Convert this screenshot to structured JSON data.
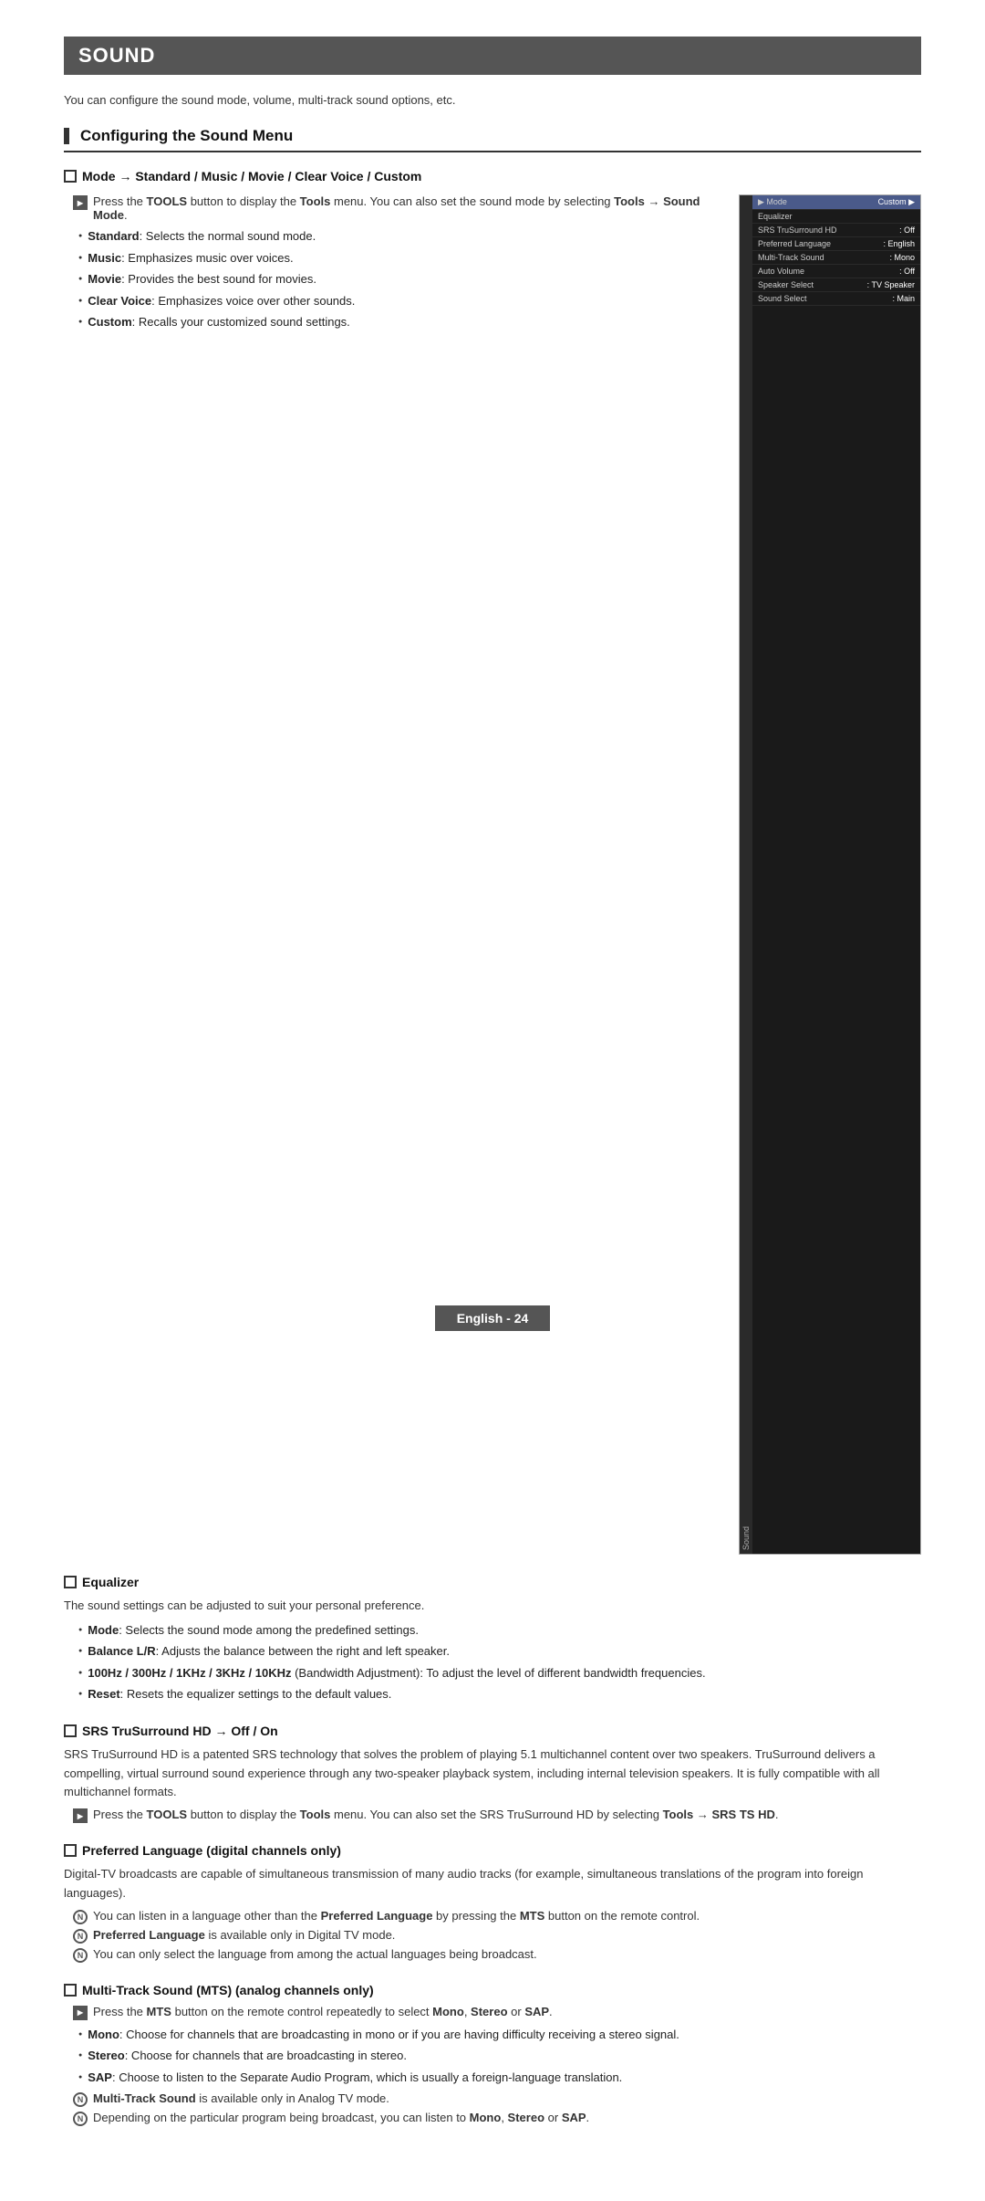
{
  "page": {
    "title": "SOUND",
    "intro": "You can configure the sound mode, volume, multi-track sound options, etc.",
    "footer_label": "English - 24"
  },
  "configuring_section": {
    "heading": "Configuring the Sound Menu"
  },
  "mode_subsection": {
    "title": "Mode → Standard / Music / Movie / Clear Voice / Custom",
    "note1": "Press the TOOLS button to display the Tools menu. You can also set the sound mode by selecting Tools → Sound Mode.",
    "bullets": [
      {
        "text": "Standard: Selects the normal sound mode."
      },
      {
        "text": "Music: Emphasizes music over voices."
      },
      {
        "text": "Movie: Provides the best sound for movies."
      },
      {
        "text": "Clear Voice: Emphasizes voice over other sounds."
      },
      {
        "text": "Custom: Recalls your customized sound settings."
      }
    ]
  },
  "tv_menu": {
    "sidebar_label": "Sound",
    "header_label": "",
    "rows": [
      {
        "label": "Mode",
        "value": "Custom",
        "highlighted": true
      },
      {
        "label": "Equalizer",
        "value": ""
      },
      {
        "label": "SRS TruSurround HD",
        "value": ": Off"
      },
      {
        "label": "Preferred Language",
        "value": ": English"
      },
      {
        "label": "Multi-Track Sound",
        "value": ": Mono"
      },
      {
        "label": "Auto Volume",
        "value": ": Off"
      },
      {
        "label": "Speaker Select",
        "value": ": TV Speaker"
      },
      {
        "label": "Sound Select",
        "value": ": Main"
      }
    ]
  },
  "equalizer_subsection": {
    "title": "Equalizer",
    "body": "The sound settings can be adjusted to suit your personal preference.",
    "bullets": [
      {
        "text": "Mode: Selects the sound mode among the predefined settings."
      },
      {
        "text": "Balance L/R: Adjusts the balance between the right and left speaker."
      },
      {
        "text": "100Hz / 300Hz / 1KHz / 3KHz / 10KHz (Bandwidth Adjustment): To adjust the level of different bandwidth frequencies."
      },
      {
        "text": "Reset: Resets the equalizer settings to the default values."
      }
    ]
  },
  "srs_subsection": {
    "title": "SRS TruSurround HD → Off / On",
    "body": "SRS TruSurround HD is a patented SRS technology that solves the problem of playing 5.1 multichannel content over two speakers. TruSurround delivers a compelling, virtual surround sound experience through any two-speaker playback system, including internal television speakers. It is fully compatible with all multichannel formats.",
    "note1": "Press the TOOLS button to display the Tools menu. You can also set the SRS TruSurround HD by selecting Tools → SRS TS HD."
  },
  "preferred_lang_subsection": {
    "title": "Preferred Language (digital channels only)",
    "body": "Digital-TV broadcasts are capable of simultaneous transmission of many audio tracks (for example, simultaneous translations of the program into foreign languages).",
    "notes": [
      {
        "type": "info",
        "text": "You can listen in a language other than the Preferred Language by pressing the MTS button on the remote control."
      },
      {
        "type": "info",
        "text": "Preferred Language is available only in Digital TV mode."
      },
      {
        "type": "info",
        "text": "You can only select the language from among the actual languages being broadcast."
      }
    ]
  },
  "multitrack_subsection": {
    "title": "Multi-Track Sound (MTS) (analog channels only)",
    "note1": "Press the MTS button on the remote control repeatedly to select Mono, Stereo or SAP.",
    "bullets": [
      {
        "text": "Mono: Choose for channels that are broadcasting in mono or if you are having difficulty receiving a stereo signal."
      },
      {
        "text": "Stereo: Choose for channels that are broadcasting in stereo."
      },
      {
        "text": "SAP: Choose to listen to the Separate Audio Program, which is usually a foreign-language translation."
      }
    ],
    "notes": [
      {
        "type": "info",
        "text": "Multi-Track Sound is available only in Analog TV mode."
      },
      {
        "type": "info",
        "text": "Depending on the particular program being broadcast, you can listen to Mono, Stereo or SAP."
      }
    ]
  }
}
